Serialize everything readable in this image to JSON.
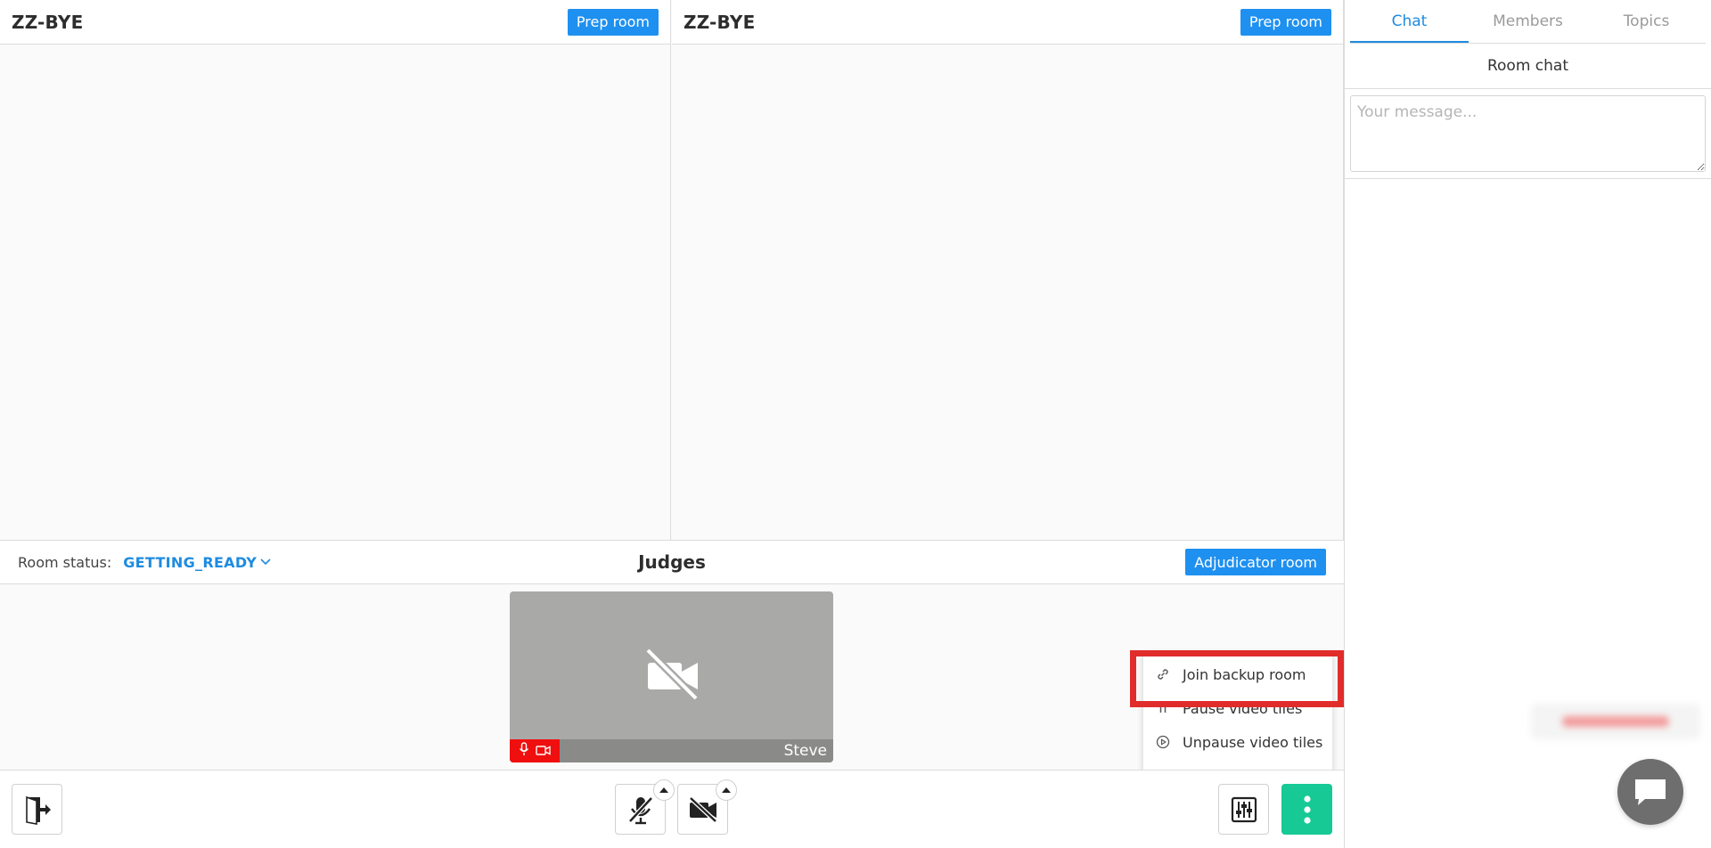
{
  "panes": [
    {
      "title": "ZZ-BYE",
      "button_label": "Prep room"
    },
    {
      "title": "ZZ-BYE",
      "button_label": "Prep room"
    }
  ],
  "judges_bar": {
    "status_label": "Room status:",
    "status_value": "GETTING_READY",
    "title": "Judges",
    "adjudicator_button": "Adjudicator room"
  },
  "video_tile": {
    "participant_name": "Steve",
    "mic_muted": true,
    "camera_off": true
  },
  "menu": {
    "items": [
      {
        "label": "Join backup room",
        "icon": "link-icon"
      },
      {
        "label": "Pause video tiles",
        "icon": "pause-icon"
      },
      {
        "label": "Unpause video tiles",
        "icon": "play-circle-icon"
      }
    ],
    "highlighted_index": 0
  },
  "toolbar": {
    "icons": [
      "exit-room-icon",
      "mic-off-icon",
      "camera-off-icon",
      "settings-sliders-icon",
      "more-vertical-icon"
    ]
  },
  "sidebar": {
    "tabs": [
      {
        "label": "Chat",
        "active": true
      },
      {
        "label": "Members",
        "active": false
      },
      {
        "label": "Topics",
        "active": false
      }
    ],
    "room_chat_title": "Room chat",
    "message_placeholder": "Your message..."
  },
  "colors": {
    "primary": "#1e90f0",
    "link_text": "#1e8be0",
    "more_button": "#16c995",
    "muted_indicator": "#f00f0f",
    "highlight_box": "#e12c2c"
  }
}
